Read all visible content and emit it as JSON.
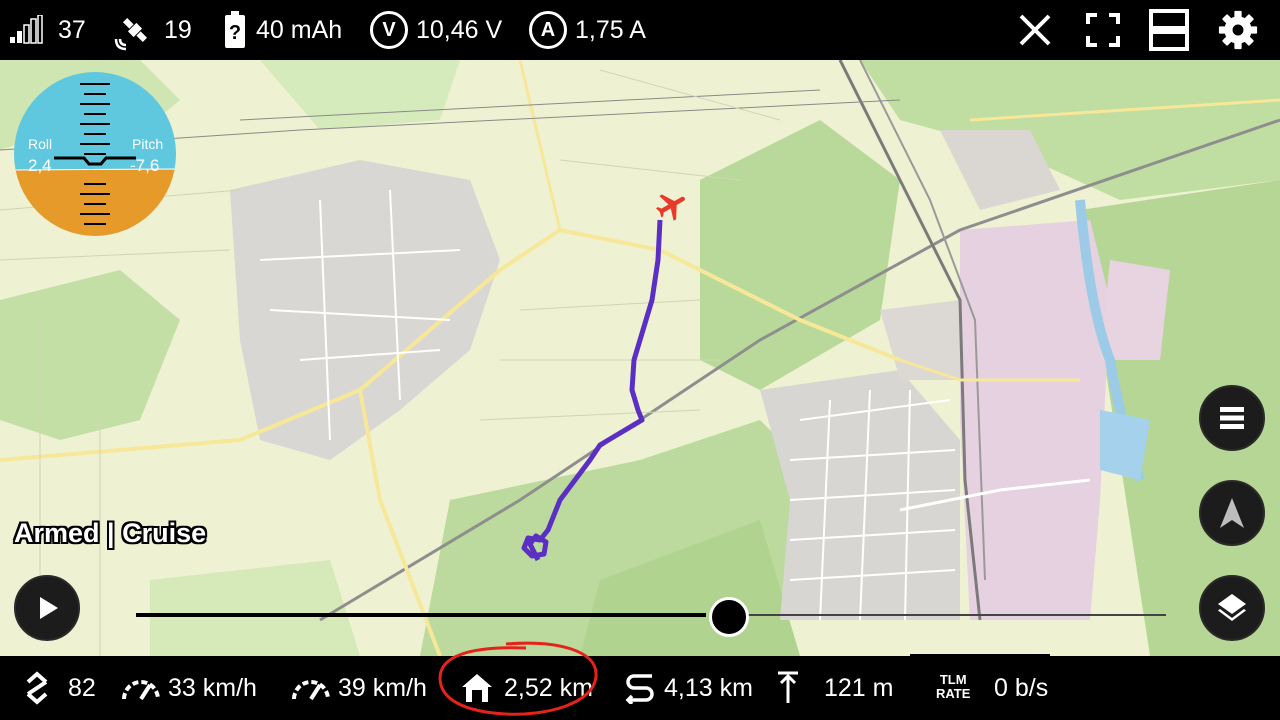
{
  "topbar": {
    "signal": "37",
    "satellites": "19",
    "battery_capacity": "40 mAh",
    "voltage_letter": "V",
    "voltage": "10,46 V",
    "current_letter": "A",
    "current": "1,75 A",
    "icons": [
      "signal-bars-icon",
      "satellite-icon",
      "battery-unknown-icon",
      "voltage-icon",
      "current-icon",
      "close-icon",
      "fullscreen-icon",
      "split-view-icon",
      "settings-icon"
    ]
  },
  "horizon": {
    "roll_label": "Roll",
    "roll_value": "2,4",
    "pitch_label": "Pitch",
    "pitch_value": "-7,6",
    "colors": {
      "sky": "#5fc8df",
      "ground": "#e59a2a"
    }
  },
  "status": {
    "mode": "Armed | Cruise"
  },
  "bottombar": {
    "climb": "82",
    "ground_speed": "33 km/h",
    "air_speed": "39 km/h",
    "home_distance": "2,52 km",
    "trip_distance": "4,13 km",
    "altitude": "121 m",
    "tlm_line1": "TLM",
    "tlm_line2": "RATE",
    "tlm_rate": "0 b/s"
  },
  "colors": {
    "track": "#5b2fc4",
    "plane": "#e8392a",
    "annotation": "#e4231b"
  }
}
